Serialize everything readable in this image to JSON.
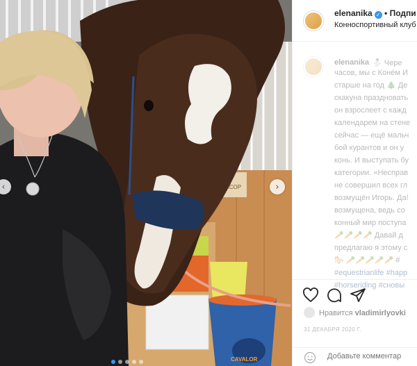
{
  "header": {
    "username": "elenanika",
    "separator": "•",
    "follow_label": "Подпи",
    "location": "Конноспортивный клуб"
  },
  "caption": {
    "username": "elenanika",
    "lines": [
      "⛄ Чере",
      "часов, мы с Конём И",
      "старше на год 🎄 Де",
      "скакуна праздновать",
      "он взрослеет с кажд",
      "календарем на стене",
      "сейчас — ещё мальч",
      "бой курантов и он у",
      "конь. И выступать бу",
      "категории. «Несправ",
      "не совершил всех гл",
      "возмущён Игорь. Да!",
      "возмущена, ведь со",
      "конный мир поступа",
      "🥕🥕🥕🥕 Давай д",
      "предлагаю я этому с",
      "🐎 🥕🥕🥕🥕🥕 #",
      "#equestrianlife #happ",
      "#horseriding #сновы"
    ]
  },
  "likes": {
    "prefix": "Нравится",
    "user": "vladimirlyovki"
  },
  "date": "31 ДЕКАБРЯ 2020 Г.",
  "comment": {
    "placeholder": "Добавьте комментар"
  },
  "photo": {
    "prev_glyph": "‹",
    "next_glyph": "›",
    "bucket_brand": "CAVALOR",
    "stall_sign": "ЛЮКСОР"
  },
  "colors": {
    "accent": "#3897f0",
    "hashtag": "#00376b",
    "text": "#262626",
    "muted": "#8e8e8e",
    "border": "#efefef"
  },
  "icons": [
    "heart-icon",
    "comment-icon",
    "share-icon",
    "smile-icon",
    "verified-icon",
    "chevron-left-icon",
    "chevron-right-icon"
  ]
}
